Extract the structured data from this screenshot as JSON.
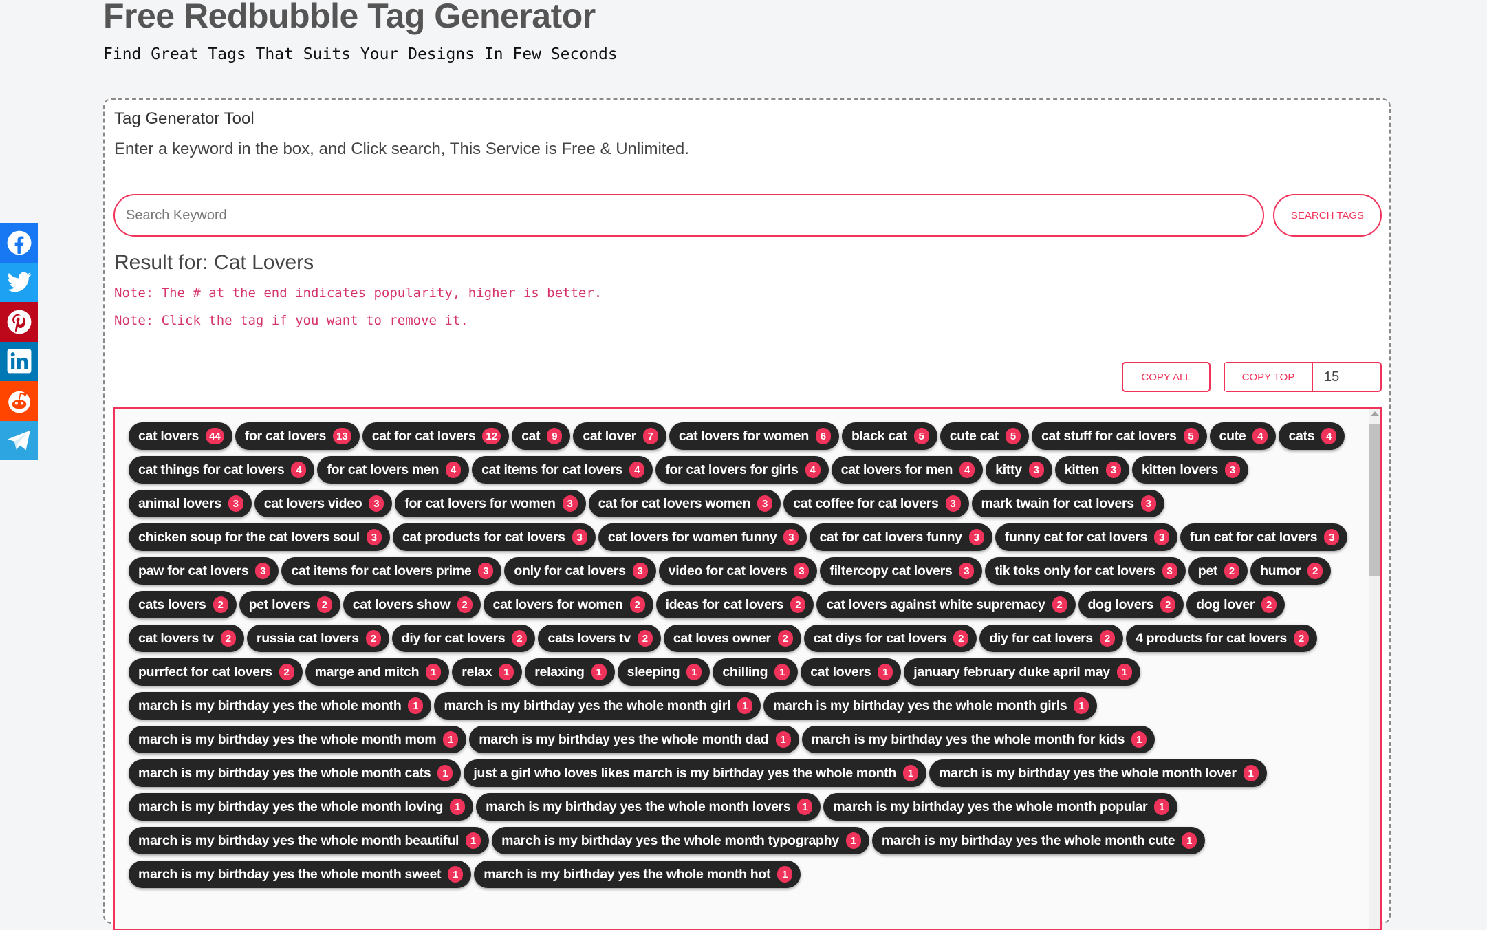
{
  "header": {
    "title": "Free Redbubble Tag Generator",
    "subtitle": "Find Great Tags That Suits Your Designs In Few Seconds"
  },
  "social": [
    {
      "name": "facebook",
      "icon": "facebook-icon",
      "color": "#1877f2"
    },
    {
      "name": "twitter",
      "icon": "twitter-icon",
      "color": "#1da1f2"
    },
    {
      "name": "pinterest",
      "icon": "pinterest-icon",
      "color": "#bd081c"
    },
    {
      "name": "linkedin",
      "icon": "linkedin-icon",
      "color": "#0077b5"
    },
    {
      "name": "reddit",
      "icon": "reddit-icon",
      "color": "#ff4500"
    },
    {
      "name": "telegram",
      "icon": "telegram-icon",
      "color": "#2ca5e0"
    }
  ],
  "tool": {
    "title": "Tag Generator Tool",
    "description": "Enter a keyword in the box, and Click search, This Service is Free & Unlimited.",
    "search_placeholder": "Search Keyword",
    "search_value": "",
    "search_button": "SEARCH TAGS",
    "result_heading": "Result for: Cat Lovers",
    "notes": [
      "Note: The # at the end indicates popularity, higher is better.",
      "Note: Click the tag if you want to remove it."
    ],
    "copy_all": "COPY ALL",
    "copy_top": "COPY TOP",
    "copy_top_count": "15"
  },
  "colors": {
    "accent": "#f0335a",
    "tag_bg": "#252525",
    "note": "#d6336c"
  },
  "tags": [
    {
      "label": "cat lovers",
      "count": "44"
    },
    {
      "label": "for cat lovers",
      "count": "13"
    },
    {
      "label": "cat for cat lovers",
      "count": "12"
    },
    {
      "label": "cat",
      "count": "9"
    },
    {
      "label": "cat lover",
      "count": "7"
    },
    {
      "label": "cat lovers for women",
      "count": "6"
    },
    {
      "label": "black cat",
      "count": "5"
    },
    {
      "label": "cute cat",
      "count": "5"
    },
    {
      "label": "cat stuff for cat lovers",
      "count": "5"
    },
    {
      "label": "cute",
      "count": "4"
    },
    {
      "label": "cats",
      "count": "4"
    },
    {
      "label": "cat things for cat lovers",
      "count": "4"
    },
    {
      "label": "for cat lovers men",
      "count": "4"
    },
    {
      "label": "cat items for cat lovers",
      "count": "4"
    },
    {
      "label": "for cat lovers for girls",
      "count": "4"
    },
    {
      "label": "cat lovers for men",
      "count": "4"
    },
    {
      "label": "kitty",
      "count": "3"
    },
    {
      "label": "kitten",
      "count": "3"
    },
    {
      "label": "kitten lovers",
      "count": "3"
    },
    {
      "label": "animal lovers",
      "count": "3"
    },
    {
      "label": "cat lovers video",
      "count": "3"
    },
    {
      "label": "for cat lovers for women",
      "count": "3"
    },
    {
      "label": "cat for cat lovers women",
      "count": "3"
    },
    {
      "label": "cat coffee for cat lovers",
      "count": "3"
    },
    {
      "label": "mark twain for cat lovers",
      "count": "3"
    },
    {
      "label": "chicken soup for the cat lovers soul",
      "count": "3"
    },
    {
      "label": "cat products for cat lovers",
      "count": "3"
    },
    {
      "label": "cat lovers for women funny",
      "count": "3"
    },
    {
      "label": "cat for cat lovers funny",
      "count": "3"
    },
    {
      "label": "funny cat for cat lovers",
      "count": "3"
    },
    {
      "label": "fun cat for cat lovers",
      "count": "3"
    },
    {
      "label": "paw for cat lovers",
      "count": "3"
    },
    {
      "label": "cat items for cat lovers prime",
      "count": "3"
    },
    {
      "label": "only for cat lovers",
      "count": "3"
    },
    {
      "label": "video for cat lovers",
      "count": "3"
    },
    {
      "label": "filtercopy cat lovers",
      "count": "3"
    },
    {
      "label": "tik toks only for cat lovers",
      "count": "3"
    },
    {
      "label": "pet",
      "count": "2"
    },
    {
      "label": "humor",
      "count": "2"
    },
    {
      "label": "cats lovers",
      "count": "2"
    },
    {
      "label": "pet lovers",
      "count": "2"
    },
    {
      "label": "cat lovers show",
      "count": "2"
    },
    {
      "label": "cat lovers for women",
      "count": "2"
    },
    {
      "label": "ideas for cat lovers",
      "count": "2"
    },
    {
      "label": "cat lovers against white supremacy",
      "count": "2"
    },
    {
      "label": "dog lovers",
      "count": "2"
    },
    {
      "label": "dog lover",
      "count": "2"
    },
    {
      "label": "cat lovers tv",
      "count": "2"
    },
    {
      "label": "russia cat lovers",
      "count": "2"
    },
    {
      "label": "diy for cat lovers",
      "count": "2"
    },
    {
      "label": "cats lovers tv",
      "count": "2"
    },
    {
      "label": "cat loves owner",
      "count": "2"
    },
    {
      "label": "cat diys for cat lovers",
      "count": "2"
    },
    {
      "label": "diy for cat lovers",
      "count": "2"
    },
    {
      "label": "4 products for cat lovers",
      "count": "2"
    },
    {
      "label": "purrfect for cat lovers",
      "count": "2"
    },
    {
      "label": "marge and mitch",
      "count": "1"
    },
    {
      "label": "relax",
      "count": "1"
    },
    {
      "label": "relaxing",
      "count": "1"
    },
    {
      "label": "sleeping",
      "count": "1"
    },
    {
      "label": "chilling",
      "count": "1"
    },
    {
      "label": "cat lovers",
      "count": "1"
    },
    {
      "label": "january february duke april may",
      "count": "1"
    },
    {
      "label": "march is my birthday yes the whole month",
      "count": "1"
    },
    {
      "label": "march is my birthday yes the whole month girl",
      "count": "1"
    },
    {
      "label": "march is my birthday yes the whole month girls",
      "count": "1"
    },
    {
      "label": "march is my birthday yes the whole month mom",
      "count": "1"
    },
    {
      "label": "march is my birthday yes the whole month dad",
      "count": "1"
    },
    {
      "label": "march is my birthday yes the whole month for kids",
      "count": "1"
    },
    {
      "label": "march is my birthday yes the whole month cats",
      "count": "1"
    },
    {
      "label": "just a girl who loves likes march is my birthday yes the whole month",
      "count": "1"
    },
    {
      "label": "march is my birthday yes the whole month lover",
      "count": "1"
    },
    {
      "label": "march is my birthday yes the whole month loving",
      "count": "1"
    },
    {
      "label": "march is my birthday yes the whole month lovers",
      "count": "1"
    },
    {
      "label": "march is my birthday yes the whole month popular",
      "count": "1"
    },
    {
      "label": "march is my birthday yes the whole month beautiful",
      "count": "1"
    },
    {
      "label": "march is my birthday yes the whole month typography",
      "count": "1"
    },
    {
      "label": "march is my birthday yes the whole month cute",
      "count": "1"
    },
    {
      "label": "march is my birthday yes the whole month sweet",
      "count": "1"
    },
    {
      "label": "march is my birthday yes the whole month hot",
      "count": "1"
    }
  ]
}
